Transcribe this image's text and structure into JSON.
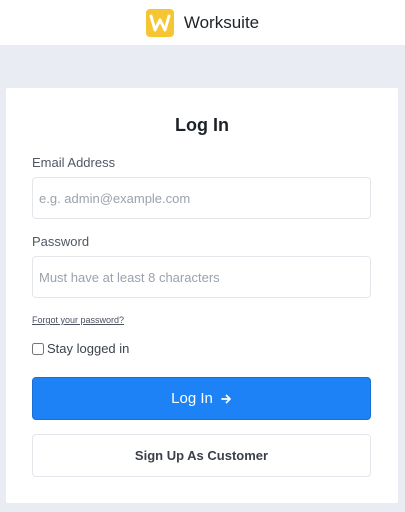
{
  "header": {
    "brand_name": "Worksuite",
    "logo_letter": "W",
    "logo_color": "#f6c532"
  },
  "login": {
    "title": "Log In",
    "email": {
      "label": "Email Address",
      "placeholder": "e.g. admin@example.com",
      "value": ""
    },
    "password": {
      "label": "Password",
      "placeholder": "Must have at least 8 characters",
      "value": ""
    },
    "forgot_link": "Forgot your password?",
    "remember_label": "Stay logged in",
    "remember_checked": false,
    "login_button": "Log In",
    "login_icon": "arrow-right-icon",
    "signup_button": "Sign Up As Customer",
    "accent_color": "#1d82f5"
  }
}
